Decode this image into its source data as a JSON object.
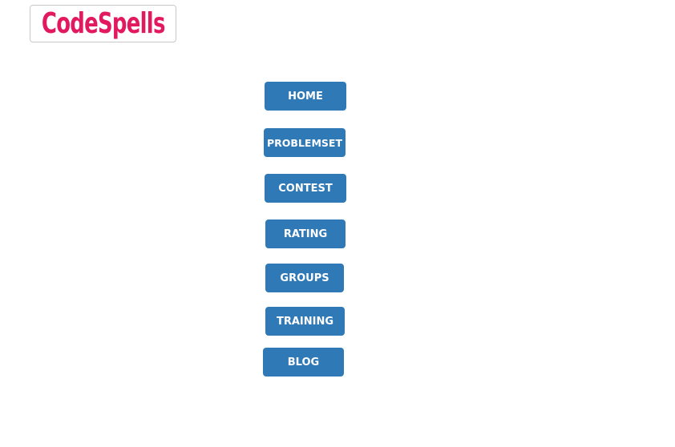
{
  "logo": {
    "text": "CodeSpells",
    "color": "#e3195f"
  },
  "nav": {
    "button_color": "#3079b7",
    "items": [
      {
        "label": "HOME"
      },
      {
        "label": "PROBLEMSET"
      },
      {
        "label": "CONTEST"
      },
      {
        "label": "RATING"
      },
      {
        "label": "GROUPS"
      },
      {
        "label": "TRAINING"
      },
      {
        "label": "BLOG"
      }
    ]
  }
}
